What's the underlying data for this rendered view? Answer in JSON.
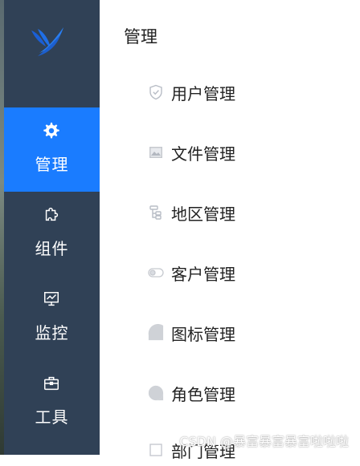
{
  "sidebar": {
    "items": [
      {
        "label": "管理",
        "icon": "gear-icon",
        "active": true
      },
      {
        "label": "组件",
        "icon": "puzzle-icon",
        "active": false
      },
      {
        "label": "监控",
        "icon": "monitor-icon",
        "active": false
      },
      {
        "label": "工具",
        "icon": "toolbox-icon",
        "active": false
      }
    ]
  },
  "submenu": {
    "title": "管理",
    "items": [
      {
        "label": "用户管理",
        "icon": "shield-icon"
      },
      {
        "label": "文件管理",
        "icon": "image-icon"
      },
      {
        "label": "地区管理",
        "icon": "tree-icon"
      },
      {
        "label": "客户管理",
        "icon": "toggle-icon"
      },
      {
        "label": "图标管理",
        "icon": "quarter-circle-icon"
      },
      {
        "label": "角色管理",
        "icon": "circle-icon"
      },
      {
        "label": "部门管理",
        "icon": "dept-icon"
      }
    ]
  },
  "watermark": "CSDN @暴富暴富暴富啦啦啦",
  "colors": {
    "sidebar_bg": "#304156",
    "active_bg": "#1a7cff",
    "icon_gray": "#c6c9cf"
  }
}
